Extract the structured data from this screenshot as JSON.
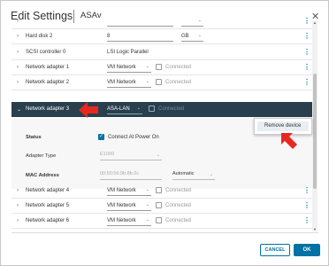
{
  "dialog": {
    "title": "Edit Settings",
    "vm_name": "ASAv",
    "close_glyph": "✕"
  },
  "rows": {
    "top_partial": {
      "value": "",
      "unit": ""
    },
    "hard_disk_2": {
      "label": "Hard disk 2",
      "value": "8",
      "unit": "GB"
    },
    "scsi_controller": {
      "label": "SCSI controller 0",
      "value": "LSI Logic Parallel"
    },
    "adapter_1": {
      "label": "Network adapter 1",
      "network": "VM Network",
      "connected": "Connected"
    },
    "adapter_2": {
      "label": "Network adapter 2",
      "network": "VM Network",
      "connected": "Connected"
    },
    "adapter_3": {
      "label": "Network adapter 3",
      "network": "ASA-LAN",
      "connected": "Connected"
    },
    "adapter_4": {
      "label": "Network adapter 4",
      "network": "VM Network",
      "connected": "Connected"
    },
    "adapter_5": {
      "label": "Network adapter 5",
      "network": "VM Network",
      "connected": "Connected"
    },
    "adapter_6": {
      "label": "Network adapter 6",
      "network": "VM Network",
      "connected": "Connected"
    }
  },
  "expanded": {
    "status_label": "Status",
    "status_value": "Connect At Power On",
    "adapter_type_label": "Adapter Type",
    "adapter_type_value": "E1000",
    "mac_label": "MAC Address",
    "mac_value": "00:50:56:9b:8b:2c",
    "mac_mode": "Automatic"
  },
  "context_menu": {
    "item": "Remove device"
  },
  "footer": {
    "cancel": "CANCEL",
    "ok": "OK"
  },
  "icons": {
    "chevron_right": "›",
    "chevron_down": "⌄",
    "kebab": "⋮",
    "check": "✓"
  },
  "colors": {
    "accent": "#0072a3",
    "selected_row": "#2a3f4d",
    "annotation_arrow": "#e8281f"
  }
}
